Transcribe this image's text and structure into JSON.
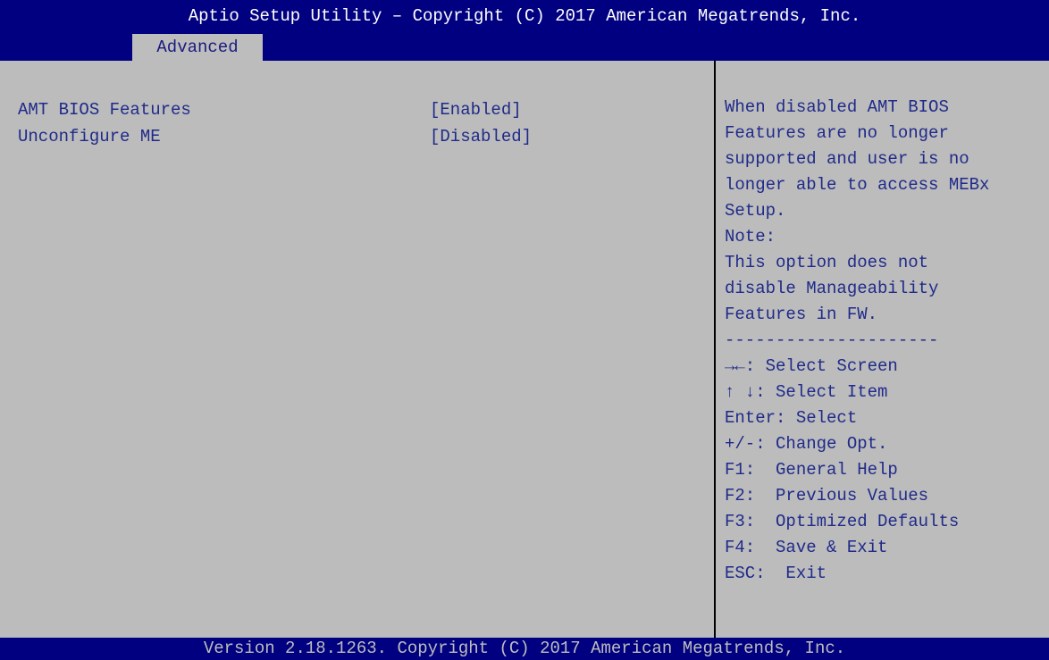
{
  "header": {
    "title": "Aptio Setup Utility – Copyright (C) 2017 American Megatrends, Inc.",
    "active_tab": "Advanced"
  },
  "settings": [
    {
      "label": "AMT BIOS Features",
      "value": "[Enabled]"
    },
    {
      "label": "Unconfigure ME",
      "value": "[Disabled]"
    }
  ],
  "help": {
    "description": [
      "When disabled AMT BIOS",
      "Features are no longer",
      "supported and user is no",
      "longer able to access MEBx",
      "Setup.",
      "Note:",
      "This option does not",
      "disable Manageability",
      "Features in FW."
    ],
    "separator": "---------------------",
    "keys": [
      "→←: Select Screen",
      "↑ ↓: Select Item",
      "Enter: Select",
      "+/-: Change Opt.",
      "F1:  General Help",
      "F2:  Previous Values",
      "F3:  Optimized Defaults",
      "F4:  Save & Exit",
      "ESC:  Exit"
    ]
  },
  "footer": {
    "text": "Version 2.18.1263. Copyright (C) 2017 American Megatrends, Inc."
  },
  "colors": {
    "header_bg": "#000080",
    "panel_bg": "#bcbcbc",
    "text": "#1f2a8a",
    "header_text": "#ffffff"
  }
}
